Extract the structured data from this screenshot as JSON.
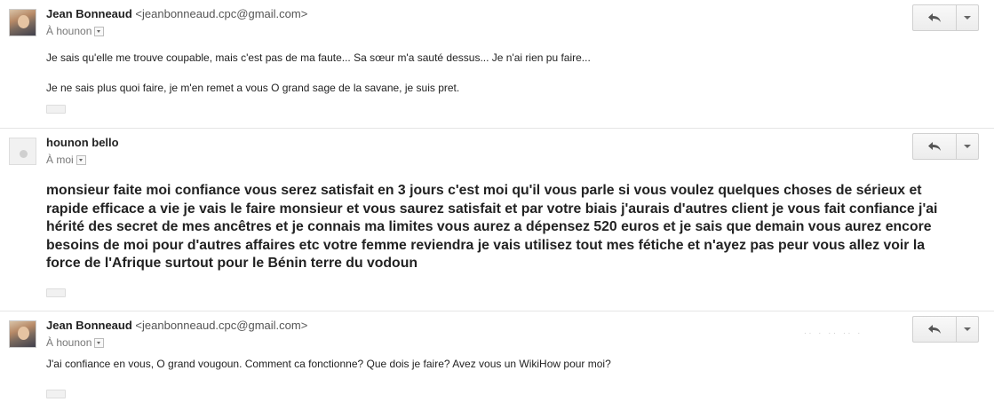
{
  "messages": [
    {
      "sender": "Jean Bonneaud",
      "email": "<jeanbonneaud.cpc@gmail.com>",
      "recipient": "À hounon",
      "paragraphs": [
        "Je sais qu'elle me trouve coupable, mais c'est pas de ma faute... Sa sœur m'a sauté dessus... Je n'ai rien pu faire...",
        "Je ne sais plus quoi faire, je m'en remet a vous O grand sage de la savane, je suis pret."
      ],
      "avatar_icon": "sender-photo"
    },
    {
      "sender": "hounon bello",
      "email": "",
      "recipient": "À moi",
      "paragraphs": [
        "monsieur faite moi confiance vous serez satisfait en 3 jours c'est  moi qu'il vous parle si vous voulez quelques choses de sérieux et rapide efficace a vie je vais le faire monsieur et vous saurez satisfait et par votre biais j'aurais d'autres client je vous fait confiance j'ai hérité des secret de mes ancêtres et je connais ma limites vous aurez a dépensez 520 euros et je sais que demain vous aurez encore besoins de moi pour d'autres affaires etc votre femme reviendra je vais utilisez tout mes fétiche et n'ayez pas peur vous allez voir la force de l'Afrique surtout pour le Bénin terre du vodoun"
      ],
      "avatar_icon": "default-avatar"
    },
    {
      "sender": "Jean Bonneaud",
      "email": "<jeanbonneaud.cpc@gmail.com>",
      "recipient": "À hounon",
      "paragraphs": [
        "J'ai confiance en vous, O grand vougoun. Comment ca fonctionne? Que dois je faire? Avez vous un WikiHow pour moi?"
      ],
      "avatar_icon": "sender-photo"
    }
  ],
  "icons": {
    "reply": "reply-arrow-icon",
    "more": "chevron-down-icon"
  },
  "colors": {
    "text": "#222222",
    "secondary": "#777777",
    "border": "#e5e5e5"
  }
}
